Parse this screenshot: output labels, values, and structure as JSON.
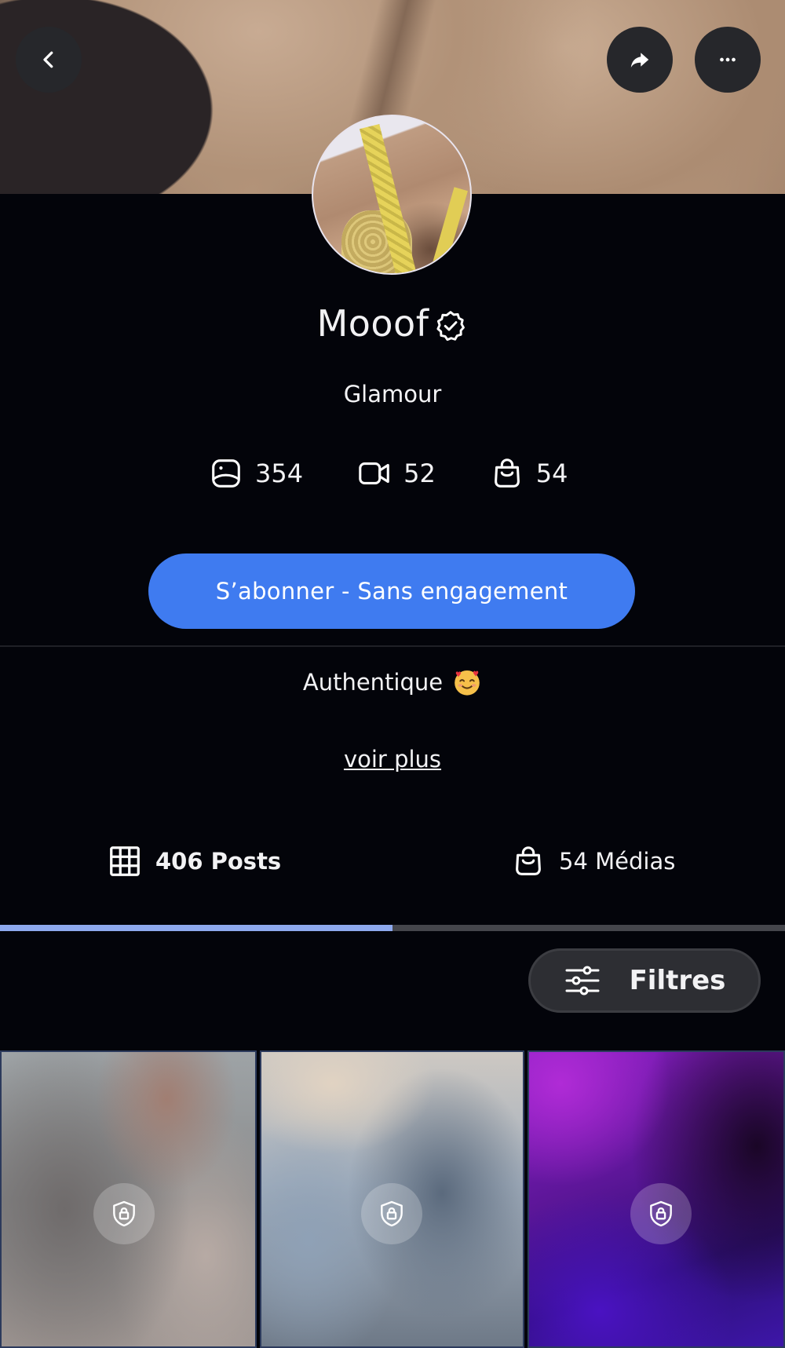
{
  "profile": {
    "name": "Mooof",
    "category": "Glamour",
    "bio": "Authentique",
    "see_more": "voir plus"
  },
  "stats": {
    "photos": "354",
    "videos": "52",
    "products": "54"
  },
  "subscribe": {
    "label": "S’abonner - Sans engagement"
  },
  "tabs": {
    "posts_label": "406 Posts",
    "media_label": "54 Médias",
    "active_progress_percent": 50
  },
  "filters": {
    "label": "Filtres"
  },
  "grid": {
    "tiles": [
      {
        "locked": true
      },
      {
        "locked": true
      },
      {
        "locked": true
      }
    ]
  },
  "colors": {
    "background": "#03040a",
    "accent": "#3f7bf0",
    "tab_indicator": "#8ea9ee"
  },
  "icons": {
    "back": "chevron-left-icon",
    "share": "share-arrow-icon",
    "more": "more-dots-icon",
    "verified": "verified-badge-icon",
    "photos": "photo-icon",
    "videos": "video-camera-icon",
    "products": "shopping-bag-icon",
    "posts": "grid-icon",
    "filters": "sliders-icon",
    "lock": "shield-lock-icon"
  }
}
